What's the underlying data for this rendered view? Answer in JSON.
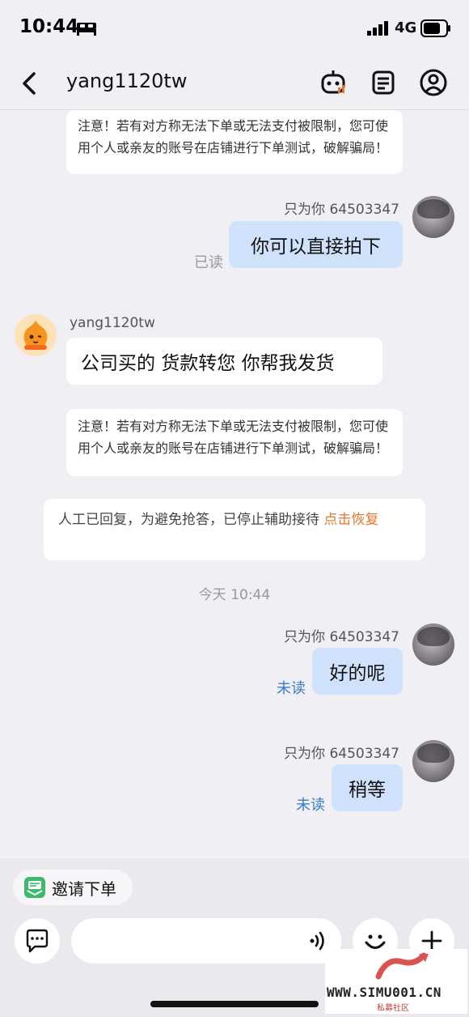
{
  "status_bar": {
    "time": "10:44",
    "network": "4G"
  },
  "header": {
    "title": "yang1120tw"
  },
  "messages": {
    "notice_text": "注意！若有对方称无法下单或无法支付被限制，您可使用个人或亲友的账号在店铺进行下单测试，破解骗局！",
    "msg1": {
      "meta": "只为你 64503347",
      "text": "你可以直接拍下",
      "status": "已读"
    },
    "msg2": {
      "sender": "yang1120tw",
      "text": "公司买的 货款转您 你帮我发货"
    },
    "system": {
      "text": "人工已回复，为避免抢答，已停止辅助接待 ",
      "link": "点击恢复"
    },
    "timestamp": "今天 10:44",
    "msg3": {
      "meta": "只为你 64503347",
      "text": "好的呢",
      "status": "未读"
    },
    "msg4": {
      "meta": "只为你 64503347",
      "text": "稍等",
      "status": "未读"
    }
  },
  "bottom": {
    "invite_label": "邀请下单",
    "input_placeholder": ""
  },
  "watermark": {
    "text": "WWW.SIMU001.CN",
    "sub": "私募社区"
  },
  "colors": {
    "accent_link": "#e0782c",
    "unread": "#3a7dc9",
    "mine_bubble": "#cfe1fb"
  }
}
